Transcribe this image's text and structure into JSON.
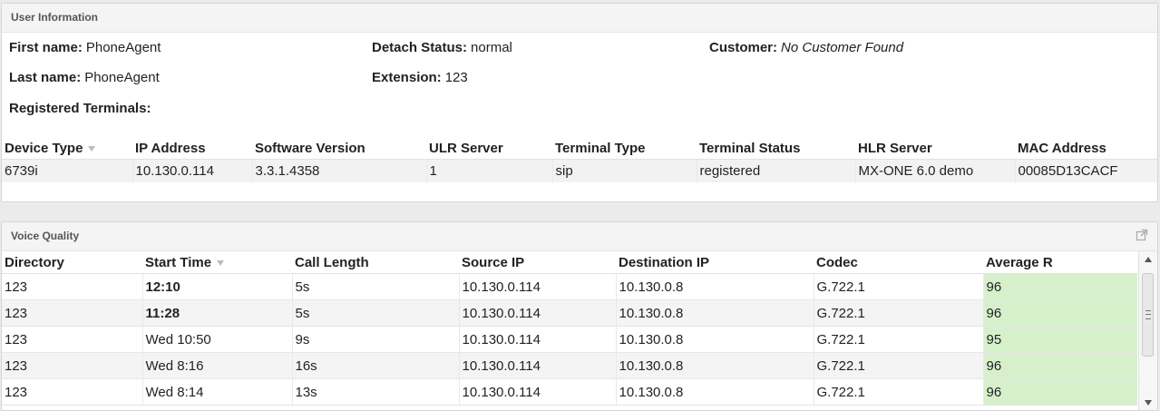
{
  "user_info": {
    "title": "User Information",
    "first_name": {
      "label": "First name:",
      "value": "PhoneAgent"
    },
    "last_name": {
      "label": "Last name:",
      "value": "PhoneAgent"
    },
    "detach_status": {
      "label": "Detach Status:",
      "value": "normal"
    },
    "extension": {
      "label": "Extension:",
      "value": "123"
    },
    "customer": {
      "label": "Customer:",
      "value": "No Customer Found"
    },
    "registered_terminals_label": "Registered Terminals:"
  },
  "terminals": {
    "columns": [
      "Device Type",
      "IP Address",
      "Software Version",
      "ULR Server",
      "Terminal Type",
      "Terminal Status",
      "HLR Server",
      "MAC Address"
    ],
    "rows": [
      [
        "6739i",
        "10.130.0.114",
        "3.3.1.4358",
        "1",
        "sip",
        "registered",
        "MX-ONE 6.0 demo",
        "00085D13CACF"
      ]
    ]
  },
  "voice_quality": {
    "title": "Voice Quality",
    "columns": [
      "Directory",
      "Start Time",
      "Call Length",
      "Source IP",
      "Destination IP",
      "Codec",
      "Average R"
    ],
    "rows": [
      [
        "123",
        "12:10",
        "5s",
        "10.130.0.114",
        "10.130.0.8",
        "G.722.1",
        "96"
      ],
      [
        "123",
        "11:28",
        "5s",
        "10.130.0.114",
        "10.130.0.8",
        "G.722.1",
        "96"
      ],
      [
        "123",
        "Wed 10:50",
        "9s",
        "10.130.0.114",
        "10.130.0.8",
        "G.722.1",
        "95"
      ],
      [
        "123",
        "Wed 8:16",
        "16s",
        "10.130.0.114",
        "10.130.0.8",
        "G.722.1",
        "96"
      ],
      [
        "123",
        "Wed 8:14",
        "13s",
        "10.130.0.114",
        "10.130.0.8",
        "G.722.1",
        "96"
      ]
    ],
    "average_r_color": "#d6f0cc"
  }
}
